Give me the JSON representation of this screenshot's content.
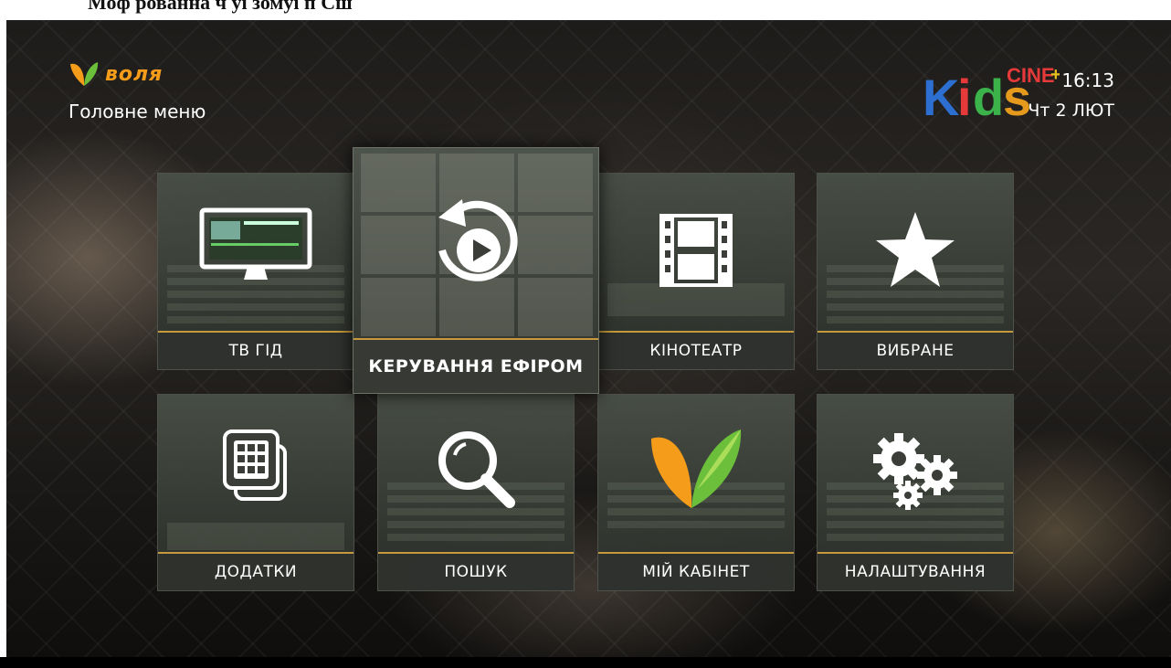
{
  "page": {
    "top_caption": "Моф рованна ч уі зомуі п Сш"
  },
  "header": {
    "brand_name": "воля",
    "menu_title": "Головне меню",
    "channel_logo": "Kids CINE+",
    "time": "16:13",
    "date": "Чт 2 ЛЮТ"
  },
  "menu": {
    "tiles": [
      {
        "label": "ТВ ГІД",
        "icon": "tv-monitor-icon"
      },
      {
        "label": "КЕРУВАННЯ ЕФІРОМ",
        "icon": "replay-play-icon",
        "selected": true
      },
      {
        "label": "КІНОТЕАТР",
        "icon": "film-strip-icon"
      },
      {
        "label": "ВИБРАНЕ",
        "icon": "star-icon"
      },
      {
        "label": "ДОДАТКИ",
        "icon": "apps-grid-icon"
      },
      {
        "label": "ПОШУК",
        "icon": "magnifier-icon"
      },
      {
        "label": "МІЙ КАБІНЕТ",
        "icon": "volia-leaf-icon"
      },
      {
        "label": "НАЛАШТУВАННЯ",
        "icon": "gears-icon"
      }
    ]
  },
  "colors": {
    "brand_orange": "#f59c1a",
    "accent_gold": "#c69a3c",
    "leaf_green": "#6bbf3a"
  }
}
